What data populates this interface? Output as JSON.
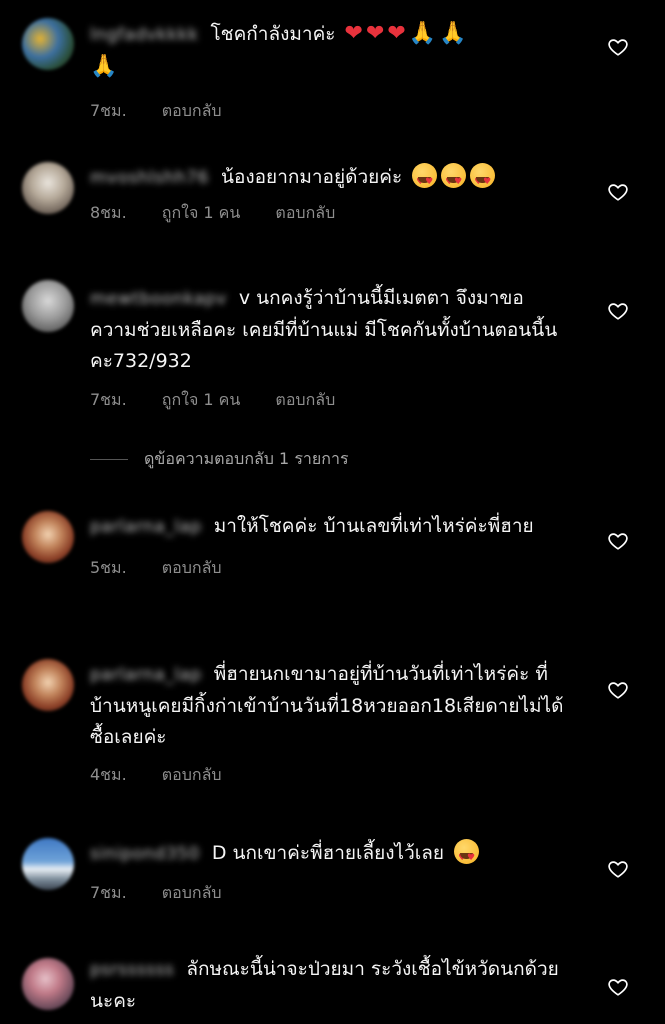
{
  "comments": [
    {
      "username": "lngfadvkkkk",
      "text": "โชคกำลังมาค่ะ",
      "time": "7ชม.",
      "likes": "",
      "reply": "ตอบกลับ"
    },
    {
      "username": "mvoshlshh76",
      "text": "น้องอยากมาอยู่ด้วยค่ะ",
      "time": "8ชม.",
      "likes": "ถูกใจ 1 คน",
      "reply": "ตอบกลับ"
    },
    {
      "username": "mewtboonkapv",
      "text": "v นกคงรู้ว่าบ้านนี้มีเมตตา  จึงมาขอความช่วยเหลือคะ เคยมีที่บ้านแม่ มีโชคกันทั้งบ้านตอนนี้นคะ732/932",
      "time": "7ชม.",
      "likes": "ถูกใจ 1 คน",
      "reply": "ตอบกลับ"
    },
    {
      "username": "parlarna_lap",
      "text": "มาให้โชคค่ะ บ้านเลขที่เท่าไหร่ค่ะพี่ฮาย",
      "time": "5ชม.",
      "likes": "",
      "reply": "ตอบกลับ"
    },
    {
      "username": "parlarna_lap",
      "text": "พี่ฮายนกเขามาอยู่ที่บ้านวันที่เท่าไหร่ค่ะ ที่บ้านหนูเคยมีกิ้งก่าเข้าบ้านวันที่18หวยออก18เสียดายไม่ได้ซื้อเลยค่ะ",
      "time": "4ชม.",
      "likes": "",
      "reply": "ตอบกลับ"
    },
    {
      "username": "sinipond350",
      "text": "D นกเขาค่ะพี่ฮายเลี้ยงไว้เลย",
      "time": "7ชม.",
      "likes": "",
      "reply": "ตอบกลับ"
    },
    {
      "username": "psrssssss",
      "text": "ลักษณะนี้น่าจะป่วยมา ระวังเชื้อไข้หวัดนกด้วยนะคะ",
      "time": "",
      "likes": "",
      "reply": ""
    }
  ],
  "view_replies": "ดูข้อความตอบกลับ 1 รายการ",
  "colors": {
    "background": "#000000",
    "text": "#f5f5f5",
    "meta": "#8e8e8e",
    "heart": "#e8323c"
  }
}
